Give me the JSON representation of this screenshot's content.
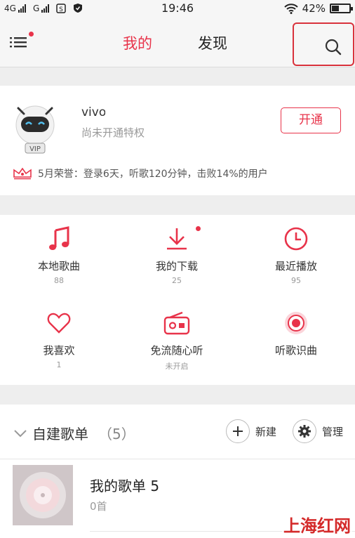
{
  "statusbar": {
    "sim1": "4G",
    "sim2": "G",
    "time": "19:46",
    "battery": "42%",
    "battery_fraction": 0.42
  },
  "nav": {
    "tab_mine": "我的",
    "tab_discover": "发现",
    "accent_color": "#e8334a"
  },
  "profile": {
    "username": "vivo",
    "avatar_badge": "VIP",
    "privilege": "尚未开通特权",
    "open_label": "开通",
    "honor": "5月荣誉：登录6天，听歌120分钟，击败14%的用户"
  },
  "grid": {
    "items": [
      {
        "label": "本地歌曲",
        "sub": "88",
        "icon": "music-note-icon"
      },
      {
        "label": "我的下载",
        "sub": "25",
        "icon": "download-icon"
      },
      {
        "label": "最近播放",
        "sub": "95",
        "icon": "clock-icon"
      },
      {
        "label": "我喜欢",
        "sub": "1",
        "icon": "heart-icon"
      },
      {
        "label": "免流随心听",
        "sub": "未开启",
        "icon": "radio-icon"
      },
      {
        "label": "听歌识曲",
        "sub": "",
        "icon": "recognize-icon"
      }
    ]
  },
  "playlists": {
    "header_title": "自建歌单",
    "header_count": "（5）",
    "new_label": "新建",
    "manage_label": "管理",
    "items": [
      {
        "name": "我的歌单 5",
        "count": "0首"
      }
    ]
  },
  "watermark": "上海红网"
}
